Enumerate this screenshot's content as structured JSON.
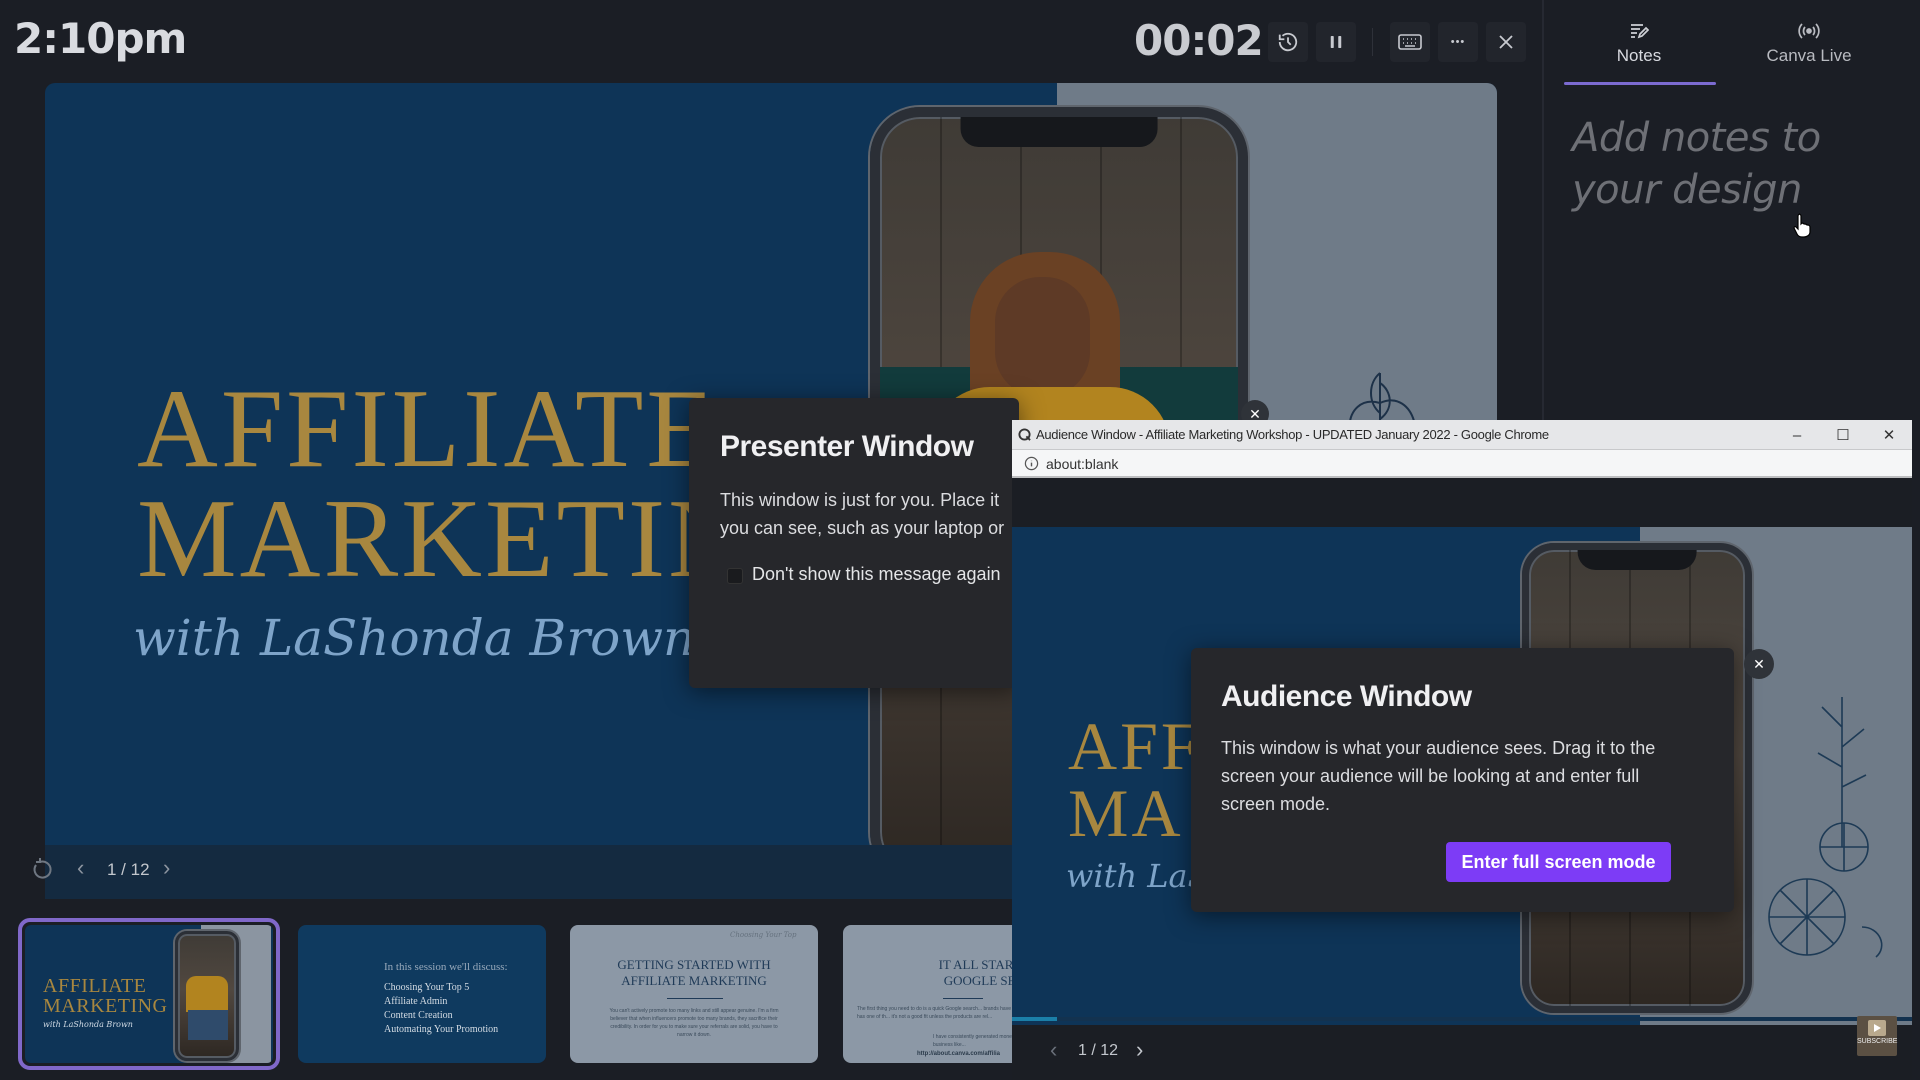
{
  "topbar": {
    "clock": "2:10pm",
    "timer": "00:02",
    "buttons": {
      "reset_timer": "reset-timer",
      "pause": "pause",
      "keyboard_shortcuts": "keyboard",
      "more": "more",
      "close": "close"
    }
  },
  "notes_panel": {
    "tabs": [
      {
        "label": "Notes",
        "icon": "notes-pencil-icon",
        "active": true
      },
      {
        "label": "Canva Live",
        "icon": "broadcast-icon",
        "active": false
      }
    ],
    "placeholder": "Add notes to your design"
  },
  "main_slide": {
    "title_line1": "AFFILIATE",
    "title_line2": "MARKETING",
    "subtitle": "with LaShonda Brown",
    "page": "1 / 12",
    "colors": {
      "background": "#0e3457",
      "title": "#a8873f",
      "script": "#7ea4c9",
      "panel": "#6f7b88"
    }
  },
  "thumbnails": [
    {
      "index": 1,
      "selected": true,
      "title_line1": "AFFILIATE",
      "title_line2": "MARKETING",
      "subtitle": "with LaShonda Brown"
    },
    {
      "index": 2,
      "heading": "In this session we'll discuss:",
      "items": [
        "Choosing Your Top 5",
        "Affiliate Admin",
        "Content Creation",
        "Automating Your Promotion"
      ]
    },
    {
      "index": 3,
      "script": "Choosing Your Top",
      "title_line1": "GETTING STARTED WITH",
      "title_line2": "AFFILIATE MARKETING",
      "body": "You can't actively promote too many links and still appear genuine. I'm a firm believer that when influencers promote too many brands, they sacrifice their credibility. In order for you to make sure your referrals are solid, you have to narrow it down."
    },
    {
      "index": 4,
      "title_line1": "IT ALL STARTS WI",
      "title_line2": "GOOGLE SEARC",
      "body": "The first thing you need to do is a quick Google search... brands have an affiliate program. Amazon has one of th... it's not a good fit unless the products are rel...",
      "body2": "I have consistently generated money from... tools I actually use in my business like...",
      "link": "http://about.canva.com/affilia"
    }
  ],
  "presenter_dialog": {
    "title": "Presenter Window",
    "body_line1": "This window is just for you. Place it",
    "body_line2": "you can see, such as your laptop or",
    "checkbox_label": "Don't show this message again",
    "checkbox_checked": false
  },
  "chrome_window": {
    "title": "Audience Window - Affiliate Marketing Workshop - UPDATED January 2022 - Google Chrome",
    "url": "about:blank",
    "minimize": "–",
    "maximize": "☐",
    "close": "✕"
  },
  "audience_slide": {
    "title_line1": "AFF",
    "title_line2": "MA",
    "subtitle": "with LaSh",
    "page": "1 / 12",
    "progress": 0.05
  },
  "audience_dialog": {
    "title": "Audience Window",
    "body": "This window is what your audience sees. Drag it to the screen your audience will be looking at and enter full screen mode.",
    "button": "Enter full screen mode",
    "button_color": "#7d3cf6"
  },
  "overlay": {
    "subscribe": "SUBSCRIBE"
  },
  "glyphs": {
    "close": "✕",
    "prev": "‹",
    "next": "›",
    "more": "•••"
  }
}
